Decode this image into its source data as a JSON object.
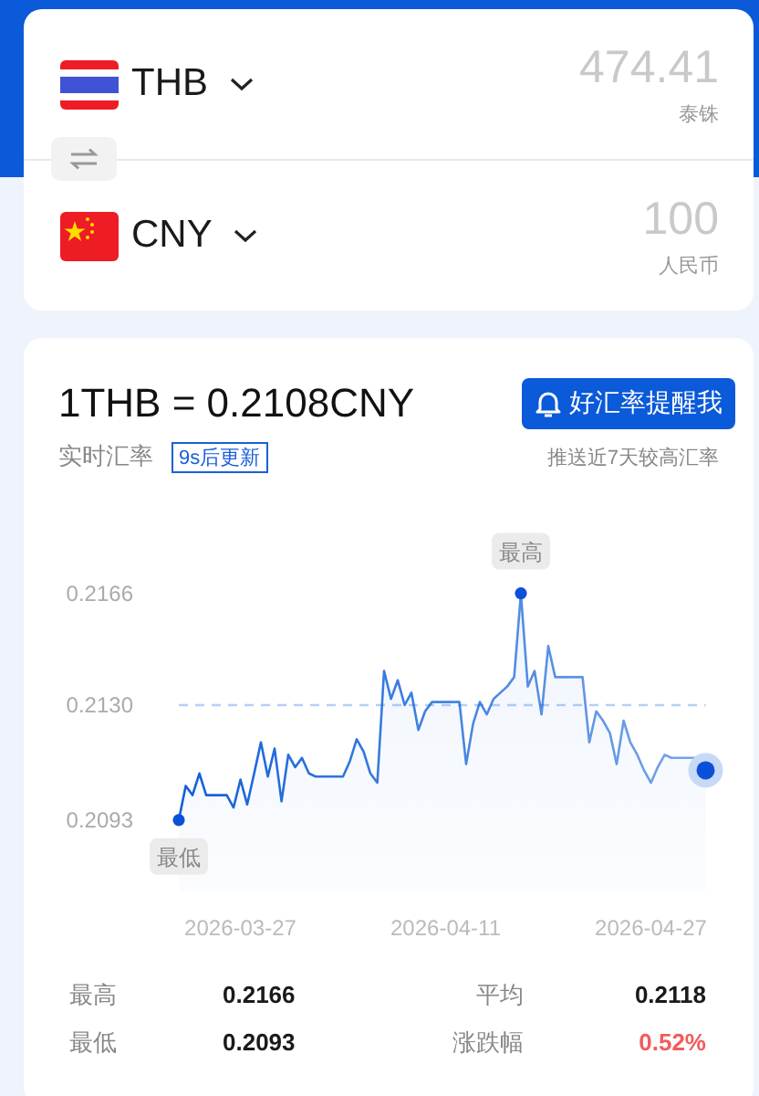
{
  "converter": {
    "currencies": [
      {
        "kind": "th",
        "code": "THB",
        "amount": "474.41",
        "name": "泰铢"
      },
      {
        "kind": "cn",
        "code": "CNY",
        "amount": "100",
        "name": "人民币"
      }
    ]
  },
  "rate": {
    "title": "1THB = 0.2108CNY",
    "label": "实时汇率",
    "countdown": "9s后更新",
    "alert_button": "好汇率提醒我",
    "alert_hint": "推送近7天较高汇率"
  },
  "chart": {
    "chart_data": {
      "type": "area",
      "categories": [
        null,
        null,
        null,
        null,
        null,
        null,
        null,
        null,
        null,
        "2026-03-27",
        null,
        null,
        null,
        null,
        null,
        null,
        null,
        null,
        null,
        null,
        null,
        null,
        null,
        null,
        null,
        null,
        null,
        null,
        null,
        null,
        null,
        null,
        null,
        null,
        null,
        null,
        null,
        null,
        null,
        "2026-04-11",
        null,
        null,
        null,
        null,
        null,
        null,
        null,
        null,
        null,
        null,
        null,
        null,
        null,
        null,
        null,
        null,
        null,
        null,
        null,
        null,
        null,
        null,
        null,
        null,
        null,
        null,
        null,
        null,
        null,
        "2026-04-27",
        null,
        null,
        null,
        null,
        null,
        null,
        null,
        null
      ],
      "series": [
        {
          "color": "#0f5fd8",
          "values": [
            0.2093,
            0.2104,
            0.2101,
            0.2108,
            0.2101,
            0.2101,
            0.2101,
            0.2101,
            0.2097,
            0.2106,
            0.2098,
            0.2108,
            0.2118,
            0.2107,
            0.2116,
            0.2099,
            0.2114,
            0.211,
            0.2113,
            0.2108,
            0.2107,
            0.2107,
            0.2107,
            0.2107,
            0.2107,
            0.2112,
            0.2119,
            0.2115,
            0.2108,
            0.2105,
            0.2141,
            0.2132,
            0.2138,
            0.213,
            0.2134,
            0.2122,
            0.2128,
            0.2131,
            0.2131,
            0.2131,
            0.2131,
            0.2131,
            0.2111,
            0.2124,
            0.2131,
            0.2127,
            0.2132,
            0.2134,
            0.2136,
            0.2139,
            0.2166,
            0.2136,
            0.2141,
            0.2127,
            0.2149,
            0.2139,
            0.2139,
            0.2139,
            0.2139,
            0.2139,
            0.2118,
            0.2128,
            0.2125,
            0.2121,
            0.2111,
            0.2125,
            0.2118,
            0.2114,
            0.2109,
            0.2105,
            0.211,
            0.2114,
            0.2113,
            0.2113,
            0.2113,
            0.2113,
            0.2113,
            0.2109
          ]
        }
      ],
      "ylim": [
        0.2093,
        0.2166
      ],
      "yticks": [
        {
          "value": 0.2093,
          "label": "0.2093"
        },
        {
          "value": 0.213,
          "label": "0.2130"
        },
        {
          "value": 0.2166,
          "label": "0.2166"
        }
      ],
      "ref_lines": [
        {
          "axis": "y",
          "value": 0.213
        }
      ],
      "annotations": [
        {
          "y": 0.2166,
          "text": "最高"
        },
        {
          "y": 0.2093,
          "text": "最低"
        }
      ]
    }
  },
  "stats": [
    {
      "label": "最高",
      "value": "0.2166",
      "color": "#1a1a1a"
    },
    {
      "label": "平均",
      "value": "0.2118",
      "color": "#1a1a1a"
    },
    {
      "label": "最低",
      "value": "0.2093",
      "color": "#1a1a1a"
    },
    {
      "label": "涨跌幅",
      "value": "0.52%",
      "color": "#f25c5c"
    }
  ]
}
